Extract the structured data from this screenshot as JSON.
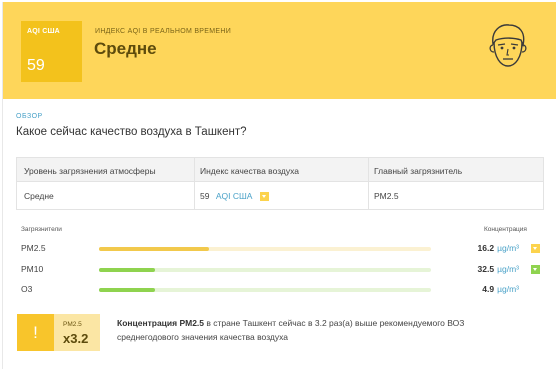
{
  "header": {
    "aqi_label": "AQI США",
    "aqi_value": "59",
    "realtime_label": "ИНДЕКС AQI В РЕАЛЬНОМ ВРЕМЕНИ",
    "status": "Средне",
    "avatar_icon": "worried-face-icon",
    "bg_color": "#fed65a",
    "box_color": "#f3c21c"
  },
  "overview": {
    "tag": "ОБЗОР",
    "question": "Какое сейчас качество воздуха в Ташкент?"
  },
  "table": {
    "headers": [
      "Уровень загрязнения атмосферы",
      "Индекс качества воздуха",
      "Главный загрязнитель"
    ],
    "level": "Средне",
    "aqi_value": "59",
    "aqi_unit": "AQI США",
    "main_pollutant": "PM2.5"
  },
  "pollutants": {
    "label_left": "Загрязнители",
    "label_right": "Концентрация",
    "items": [
      {
        "name": "PM2.5",
        "value": "16.2",
        "unit": "µg/m³",
        "fill": 0.33,
        "color": "#f2c94c",
        "track": "#fbf1d2",
        "badge": "#fcd34d"
      },
      {
        "name": "PM10",
        "value": "32.5",
        "unit": "µg/m³",
        "fill": 0.17,
        "color": "#8fd34f",
        "track": "#e6f4d7",
        "badge": "#8fd34f"
      },
      {
        "name": "O3",
        "value": "4.9",
        "unit": "µg/m³",
        "fill": 0.17,
        "color": "#8fd34f",
        "track": "#e6f4d7",
        "badge": null
      }
    ]
  },
  "warning": {
    "icon": "!",
    "pollutant": "PM2.5",
    "multiplier": "x3.2",
    "text_bold": "Концентрация PM2.5",
    "text_rest": " в стране Ташкент сейчас в 3.2 раз(а) выше рекомендуемого ВОЗ среднегодового значения качества воздуха"
  }
}
